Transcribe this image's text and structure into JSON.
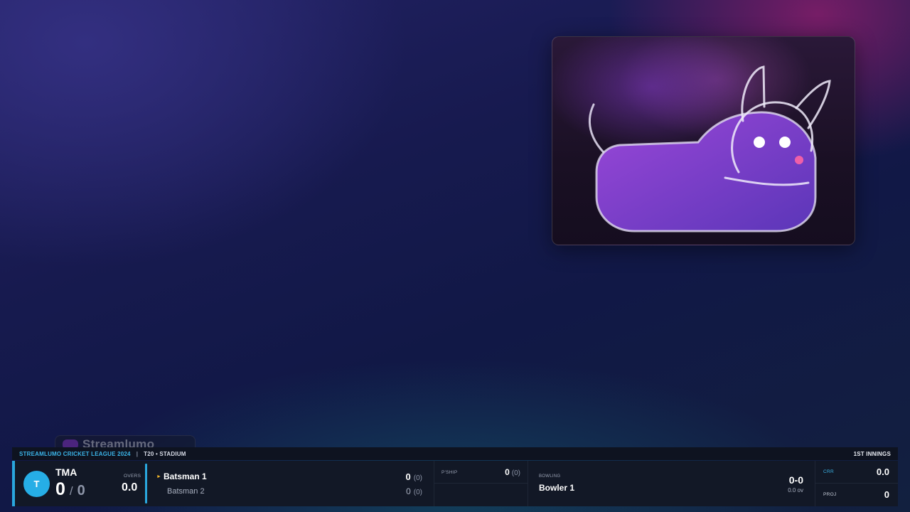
{
  "webcam": {
    "label": "webcam-feed"
  },
  "brand_chip": {
    "text": "Streamlumo"
  },
  "scoreboard": {
    "league": "STREAMLUMO CRICKET LEAGUE 2024",
    "separator": "|",
    "venue": "T20 • STADIUM",
    "innings": "1ST INNINGS",
    "team": {
      "badge_letter": "T",
      "name": "TMA",
      "runs": "0",
      "slash": "/",
      "wickets": "0",
      "overs_label": "OVERS",
      "overs": "0.0"
    },
    "batting": [
      {
        "name": "Batsman 1",
        "runs": "0",
        "balls": "(0)",
        "on_strike": true,
        "strike_marker": "►"
      },
      {
        "name": "Batsman 2",
        "runs": "0",
        "balls": "(0)",
        "on_strike": false
      }
    ],
    "partnership": {
      "label": "P'SHIP",
      "runs": "0",
      "balls": "(0)"
    },
    "bowling": {
      "label": "BOWLING",
      "name": "Bowler 1",
      "figures": "0-0",
      "overs": "0.0 ov"
    },
    "rates": {
      "crr_label": "CRR",
      "crr": "0.0",
      "proj_label": "PROJ",
      "proj": "0"
    },
    "colors": {
      "accent": "#2aa7de",
      "league_text": "#3bb4e8",
      "strike_marker": "#f0b429",
      "panel": "#121826"
    }
  }
}
